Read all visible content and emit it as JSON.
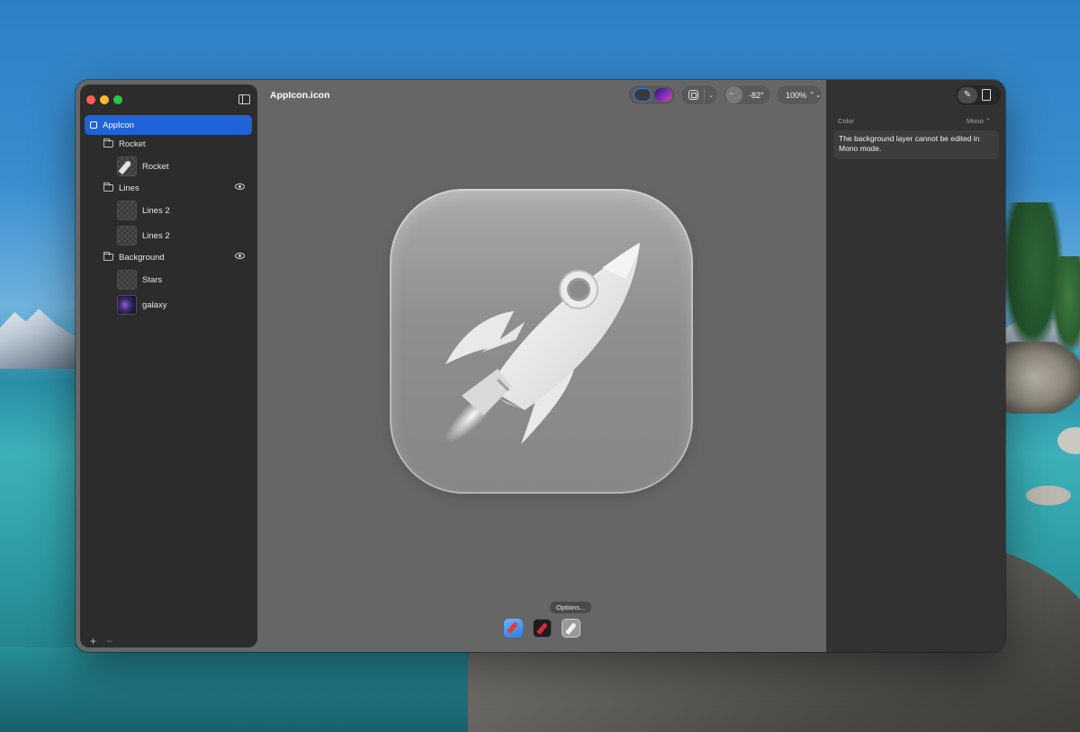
{
  "window": {
    "title": "AppIcon.icon"
  },
  "sidebar": {
    "items": [
      {
        "label": "AppIcon",
        "kind": "root",
        "icon": "app-square-icon",
        "selected": true
      },
      {
        "label": "Rocket",
        "kind": "group",
        "icon": "folder-icon"
      },
      {
        "label": "Rocket",
        "kind": "layer",
        "icon": "rocket-thumbnail"
      },
      {
        "label": "Lines",
        "kind": "group",
        "icon": "folder-icon",
        "visibility_icon": "eye-icon"
      },
      {
        "label": "Lines 2",
        "kind": "layer",
        "icon": "transparent-thumbnail"
      },
      {
        "label": "Lines 2",
        "kind": "layer",
        "icon": "transparent-thumbnail"
      },
      {
        "label": "Background",
        "kind": "group",
        "icon": "folder-icon",
        "visibility_icon": "eye-icon"
      },
      {
        "label": "Stars",
        "kind": "layer",
        "icon": "transparent-thumbnail"
      },
      {
        "label": "galaxy",
        "kind": "layer",
        "icon": "galaxy-thumbnail"
      }
    ],
    "add_label": "+",
    "remove_label": "−"
  },
  "toolbar": {
    "angle_icon": "~",
    "angle_value": "-82°",
    "zoom_value": "100%",
    "updown_icon": "⌃⌄"
  },
  "canvas": {
    "options_label": "Options...",
    "variants": [
      "default",
      "dark",
      "mono"
    ],
    "selected_variant": "mono"
  },
  "inspector": {
    "section_label": "Color",
    "mode_select": "Mono ⌃",
    "note": "The background layer cannot be edited in Mono mode."
  },
  "colors": {
    "accent": "#1f63d6",
    "canvas_bg": "#666666",
    "sidebar_bg": "#2c2c2c",
    "inspector_bg": "#323232"
  }
}
